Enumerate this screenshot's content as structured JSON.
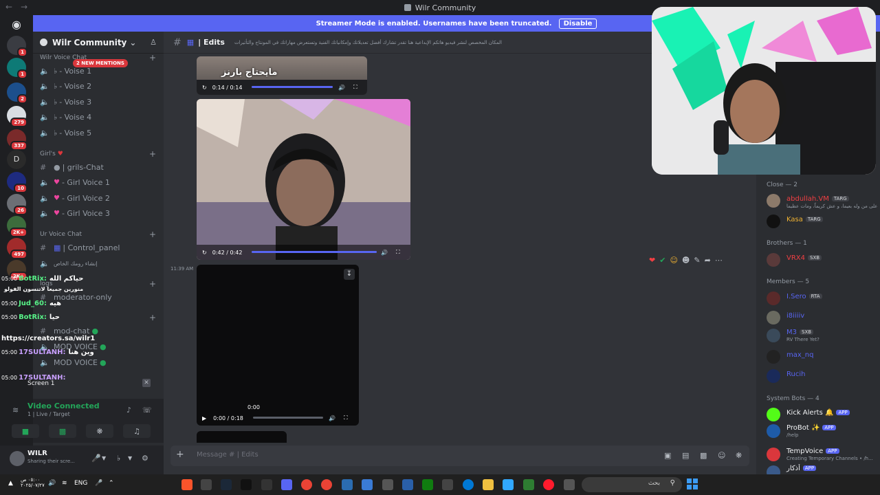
{
  "window": {
    "title": "Wilr Community"
  },
  "banner": {
    "text": "Streamer Mode is enabled. Usernames have been truncated.",
    "disable_label": "Disable"
  },
  "rail": {
    "badges": [
      "1",
      "1",
      "2",
      "279",
      "337",
      "10",
      "26",
      "2K+",
      "497",
      "2K+"
    ]
  },
  "guild": {
    "name": "Wilr Community"
  },
  "sidebar": {
    "mentions_pill": "2 NEW MENTIONS",
    "categories": [
      {
        "label": "Wilr Voice Chat"
      },
      {
        "label": "Girl's"
      },
      {
        "label": "Ur Voice Chat"
      },
      {
        "label": "logs"
      }
    ],
    "voice_channels": [
      "- Voise 1",
      "- Voise 2",
      "- Voise 3",
      "- Voise 4",
      "- Voise 5"
    ],
    "girls_channels": [
      "| grils-Chat",
      "- Girl Voice 1",
      "- Girl Voice 2",
      "- Girl Voice 3"
    ],
    "ur_channels": [
      "| Control_panel",
      "إنشاء رومك الخاص"
    ],
    "log_channels": [
      "moderator-only",
      "mod-chat",
      "MOD VOICE",
      "MOD VOICE"
    ]
  },
  "overlay_chat": [
    {
      "time": "05:00",
      "name": "BotRix:",
      "msg": "حياكم الله"
    },
    {
      "time": "",
      "name": "",
      "msg": "منورين جميعا لاتنسون الفولو"
    },
    {
      "time": "05:00",
      "name": "Jud_60:",
      "msg": "هيه"
    },
    {
      "time": "05:00",
      "name": "BotRix:",
      "msg": "حيا"
    },
    {
      "time": "",
      "name": "",
      "msg": "https://creators.sa/wilr1"
    },
    {
      "time": "05:00",
      "name": "17SULTANH:",
      "msg": "وين هنا"
    },
    {
      "time": "05:00",
      "name": "17SULTANH:",
      "msg": ""
    }
  ],
  "voice_panel": {
    "screen_label": "Screen 1",
    "status": "Video Connected",
    "sub": "1 | Live / Target"
  },
  "user": {
    "name": "WILR",
    "status": "Sharing their scre..."
  },
  "channel_header": {
    "name": "| Edits",
    "topic": "المكان المخصص لنشر فيديو هاتكم الإبداعية هنا تقدر تشارك أفضل تعديلاتك وإمكانياتك الفنية وتستعرض مهاراتك في المونتاج والتأثيرات"
  },
  "messages": {
    "video1": {
      "caption": "مايحتاج بارنز",
      "time": "0:14 / 0:14",
      "progress": 1.0
    },
    "video2": {
      "time": "0:42 / 0:42",
      "progress": 1.0
    },
    "timestamp": "11:39 AM",
    "video3": {
      "center_time": "0:00",
      "time": "0:00 / 0:18",
      "progress": 0.0
    }
  },
  "composer": {
    "placeholder": "Message # | Edits"
  },
  "members": {
    "groups": [
      {
        "label": "Close — 2",
        "items": [
          {
            "name": "abdullah.VM",
            "tag": "TARG",
            "sub": "على من وله بعيما، و عش كريماً، ومات عظيما",
            "color": "#f23f43"
          },
          {
            "name": "Kasa",
            "tag": "TARG",
            "sub": "",
            "color": "#f0b232"
          }
        ]
      },
      {
        "label": "Brothers — 1",
        "items": [
          {
            "name": "VRX4",
            "tag": "SXB",
            "sub": "",
            "color": "#f23f43"
          }
        ]
      },
      {
        "label": "Members — 5",
        "items": [
          {
            "name": "I.Sero",
            "tag": "RTA",
            "sub": "",
            "color": "#5865f2"
          },
          {
            "name": "i8iiiiv",
            "tag": "",
            "sub": "",
            "color": "#5865f2"
          },
          {
            "name": "M3",
            "tag": "SXB",
            "sub": "RV There Yet?",
            "color": "#5865f2"
          },
          {
            "name": "max_nq",
            "tag": "",
            "sub": "",
            "color": "#5865f2"
          },
          {
            "name": "Rucih",
            "tag": "",
            "sub": "",
            "color": "#5865f2"
          }
        ]
      },
      {
        "label": "System Bots — 4",
        "items": [
          {
            "name": "Kick Alerts",
            "tag": "APP",
            "sub": "",
            "color": "#f2f3f5"
          },
          {
            "name": "ProBot",
            "tag": "APP",
            "sub": "/help",
            "color": "#f2f3f5"
          },
          {
            "name": "TempVoice",
            "tag": "APP",
            "sub": "Creating Temporary Channels • /h...",
            "color": "#f2f3f5"
          },
          {
            "name": "أذكار",
            "tag": "APP",
            "sub": "",
            "color": "#f2f3f5"
          }
        ]
      }
    ]
  },
  "taskbar": {
    "lang": "ENG",
    "search_placeholder": "بحث",
    "time": "٠٥:٠٠ ص",
    "date": "٢٠٢٥/٠٧/٢٧"
  },
  "colors": {
    "blurple": "#5865f2",
    "green": "#23a559",
    "red": "#da373c"
  }
}
